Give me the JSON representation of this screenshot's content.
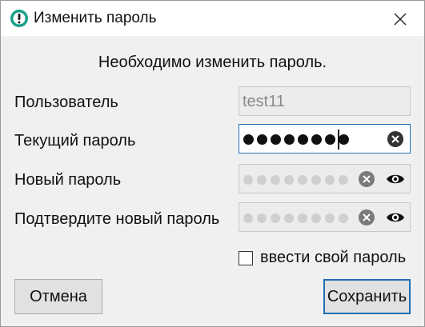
{
  "window": {
    "title": "Изменить пароль",
    "app_icon": "alert-icon"
  },
  "heading": "Необходимо изменить пароль.",
  "fields": {
    "user": {
      "label": "Пользователь",
      "value": "test11"
    },
    "current": {
      "label": "Текущий пароль",
      "masked_chars": 8
    },
    "new": {
      "label": "Новый пароль",
      "masked_chars": 8
    },
    "confirm": {
      "label": "Подтвердите новый пароль",
      "masked_chars": 8
    }
  },
  "checkbox": {
    "label": "ввести свой пароль",
    "checked": false
  },
  "buttons": {
    "cancel": "Отмена",
    "save": "Сохранить"
  },
  "colors": {
    "accent": "#1f6fb3",
    "icon_teal": "#1aa08a"
  }
}
